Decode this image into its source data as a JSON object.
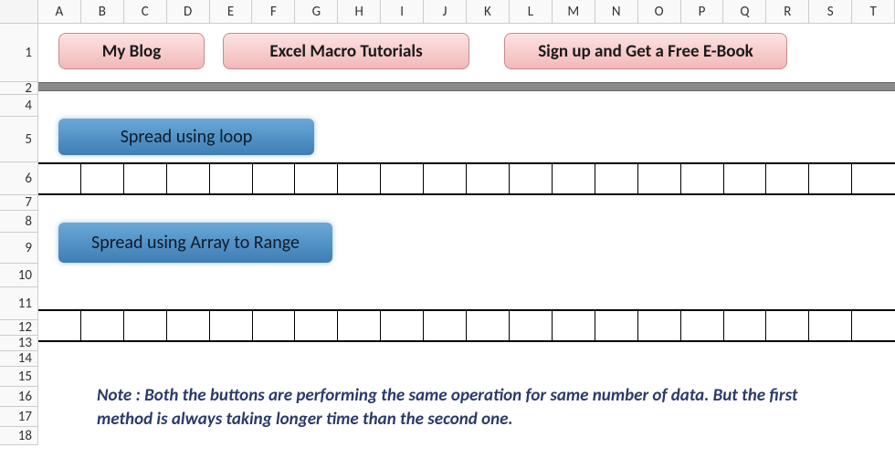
{
  "columns": [
    "A",
    "B",
    "C",
    "D",
    "E",
    "F",
    "G",
    "H",
    "I",
    "J",
    "K",
    "L",
    "M",
    "N",
    "O",
    "P",
    "Q",
    "R",
    "S",
    "T"
  ],
  "rows": [
    "1",
    "2",
    "4",
    "5",
    "6",
    "7",
    "8",
    "9",
    "10",
    "11",
    "12",
    "13",
    "14",
    "15",
    "16",
    "17",
    "18"
  ],
  "buttons": {
    "blog": "My Blog",
    "tutorials": "Excel Macro Tutorials",
    "signup": "Sign up and Get a Free E-Book",
    "spread_loop": "Spread using loop",
    "spread_array": "Spread using Array to Range"
  },
  "note": "Note : Both the buttons are performing the same operation for same number of data. But the first method is always taking longer time than the second one."
}
